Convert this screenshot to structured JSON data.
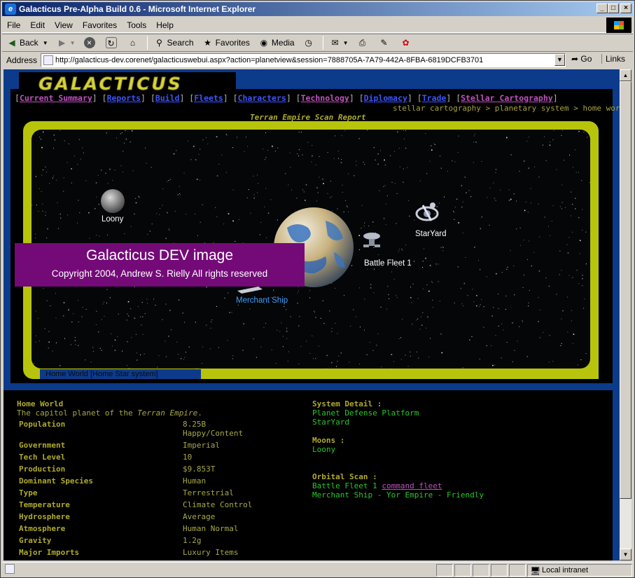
{
  "window": {
    "title": "Galacticus Pre-Alpha Build 0.6 - Microsoft Internet Explorer",
    "controls": [
      "_",
      "□",
      "×"
    ]
  },
  "menu": [
    "File",
    "Edit",
    "View",
    "Favorites",
    "Tools",
    "Help"
  ],
  "toolbar": {
    "back": "Back",
    "search": "Search",
    "favorites": "Favorites",
    "media": "Media"
  },
  "address": {
    "label": "Address",
    "url": "http://galacticus-dev.corenet/galacticuswebui.aspx?action=planetview&session=7888705A-7A79-442A-8FBA-6819DCFB3701",
    "go": "Go",
    "links": "Links"
  },
  "status": {
    "zone": "Local intranet"
  },
  "page": {
    "logo": "GALACTICUS",
    "nav": [
      {
        "label": "Current Summary",
        "style": "visited"
      },
      {
        "label": "Reports",
        "style": "blue"
      },
      {
        "label": "Build",
        "style": "blue"
      },
      {
        "label": "Fleets",
        "style": "blue"
      },
      {
        "label": "Characters",
        "style": "blue"
      },
      {
        "label": "Technology",
        "style": "visited"
      },
      {
        "label": "Diplomacy",
        "style": "blue"
      },
      {
        "label": "Trade",
        "style": "blue"
      },
      {
        "label": "Stellar Cartography",
        "style": "visited"
      }
    ],
    "breadcrumb": "stellar cartography > planetary system > home world",
    "scan_title": "Terran Empire Scan Report",
    "scan_tab": "Home World [Home Star system]",
    "objects": {
      "moon": "Loony",
      "station": "StarYard",
      "fleet": "Battle Fleet 1",
      "merchant": "Merchant Ship"
    },
    "watermark": {
      "line1": "Galacticus DEV image",
      "line2": "Copyright 2004, Andrew S. Rielly All rights reserved"
    },
    "details": {
      "heading": "Home World",
      "desc_prefix": "The capitol planet of the ",
      "desc_empire": "Terran Empire",
      "desc_suffix": ".",
      "rows": [
        {
          "label": "Population",
          "value": "8.25B"
        },
        {
          "label": "",
          "value": "Happy/Content"
        },
        {
          "label": "Government",
          "value": "Imperial"
        },
        {
          "label": "Tech Level",
          "value": "10"
        },
        {
          "label": "Production",
          "value": "$9.853T"
        },
        {
          "label": "Dominant Species",
          "value": "Human"
        },
        {
          "label": "Type",
          "value": "Terrestrial"
        },
        {
          "label": "Temperature",
          "value": "Climate Control"
        },
        {
          "label": "Hydrosphere",
          "value": "Average"
        },
        {
          "label": "Atmosphere",
          "value": "Human Normal"
        },
        {
          "label": "Gravity",
          "value": "1.2g"
        },
        {
          "label": "Major Imports",
          "value": "Luxury Items"
        }
      ]
    },
    "system": {
      "detail_heading": "System Detail :",
      "detail_items": [
        "Planet Defense Platform",
        "StarYard"
      ],
      "moons_heading": "Moons :",
      "moons": [
        "Loony"
      ],
      "orbital_heading": "Orbital Scan :",
      "fleet_name": "Battle Fleet 1",
      "fleet_cmd": "command fleet",
      "merchant_line": "Merchant Ship - Yor Empire - Friendly"
    }
  }
}
